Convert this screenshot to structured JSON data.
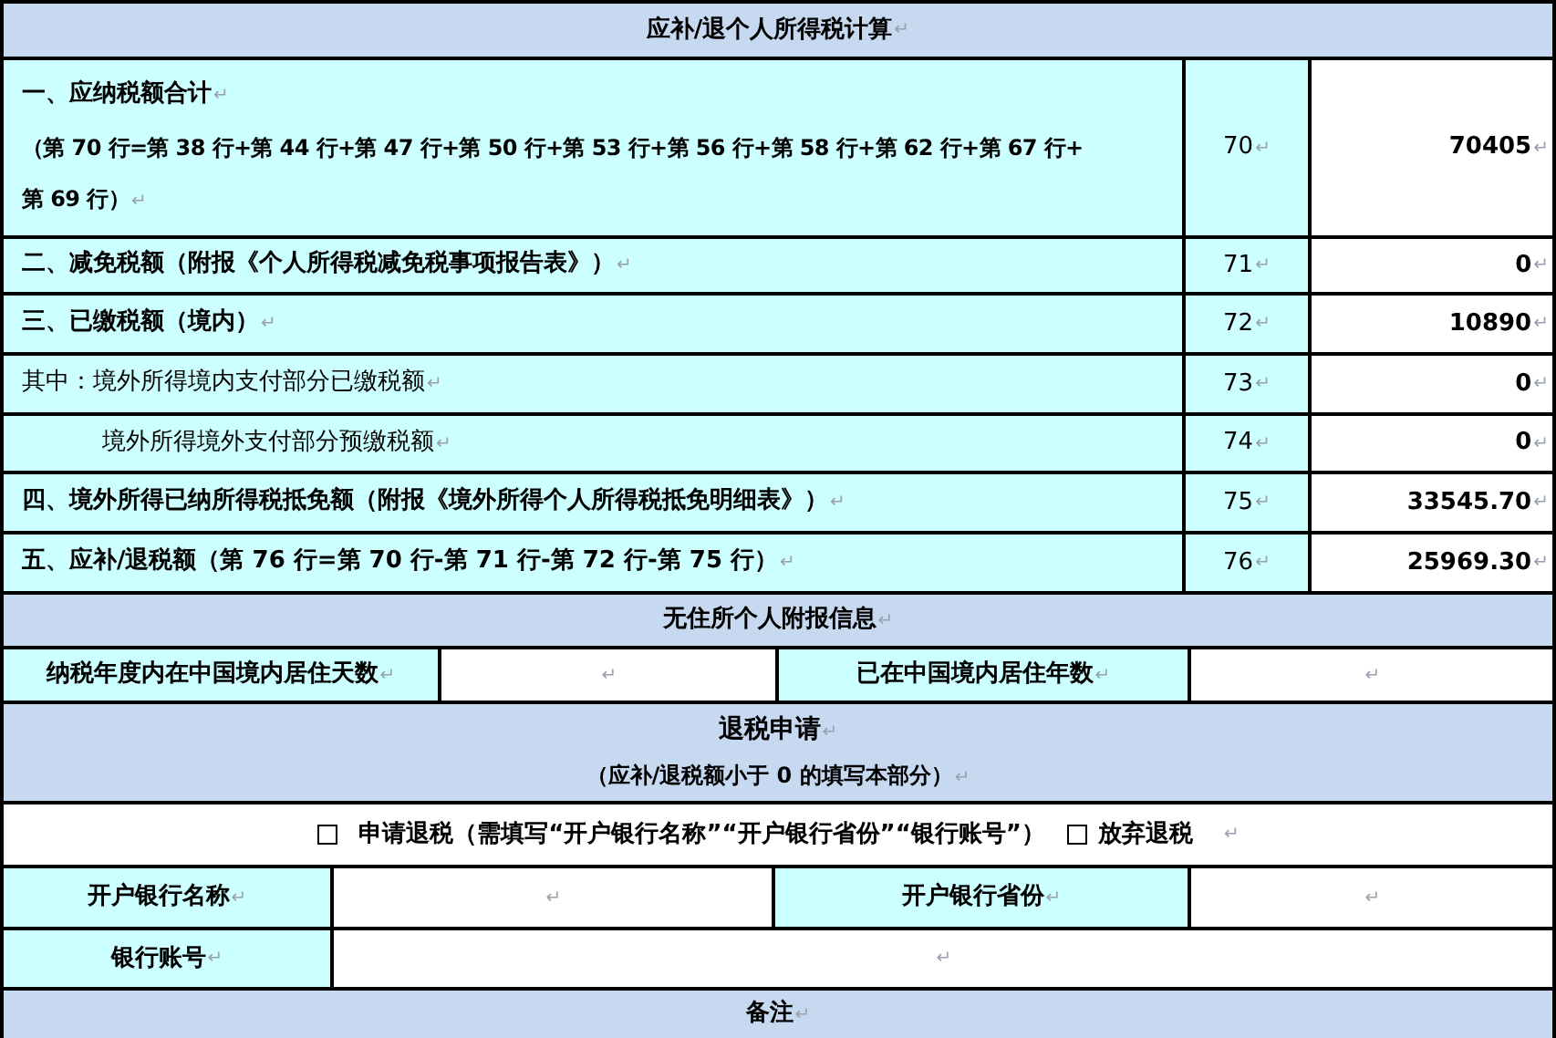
{
  "title": {
    "text": "应补/退个人所得税计算",
    "mark": "↵"
  },
  "tax_rows": [
    {
      "kind": "heading",
      "label": "一、应纳税额合计",
      "label_mark": "↵",
      "note_lines": [
        "（第 70 行=第 38 行+第 44 行+第 47 行+第 50 行+第 53 行+第 56 行+第 58 行+第 62 行+第 67 行+",
        "第 69 行）"
      ],
      "note_mark": "↵",
      "line": "70",
      "line_mark": "↵",
      "value": "70405",
      "value_mark": "↵"
    },
    {
      "kind": "heading",
      "label": "二、减免税额（附报《个人所得税减免税事项报告表》）",
      "label_mark": "↵",
      "line": "71",
      "line_mark": "↵",
      "value": "0",
      "value_mark": "↵"
    },
    {
      "kind": "heading",
      "label": "三、已缴税额（境内）",
      "label_mark": "↵",
      "line": "72",
      "line_mark": "↵",
      "value": "10890",
      "value_mark": "↵"
    },
    {
      "kind": "sub",
      "label": "其中：境外所得境内支付部分已缴税额",
      "label_mark": "↵",
      "line": "73",
      "line_mark": "↵",
      "value": "0",
      "value_mark": "↵"
    },
    {
      "kind": "subitem",
      "label": "境外所得境外支付部分预缴税额",
      "label_mark": "↵",
      "line": "74",
      "line_mark": "↵",
      "value": "0",
      "value_mark": "↵"
    },
    {
      "kind": "heading",
      "label": "四、境外所得已纳所得税抵免额（附报《境外所得个人所得税抵免明细表》）",
      "label_mark": "↵",
      "line": "75",
      "line_mark": "↵",
      "value": "33545.70",
      "value_mark": "↵"
    },
    {
      "kind": "heading",
      "label": "五、应补/退税额（第 76 行=第 70 行-第 71 行-第 72 行-第 75 行）",
      "label_mark": "↵",
      "line": "76",
      "line_mark": "↵",
      "value": "25969.30",
      "value_mark": "↵"
    }
  ],
  "nonresident": {
    "title": "无住所个人附报信息",
    "title_mark": "↵",
    "fields": [
      {
        "label": "纳税年度内在中国境内居住天数",
        "label_mark": "↵",
        "value_mark": "↵"
      },
      {
        "label": "已在中国境内居住年数",
        "label_mark": "↵",
        "value_mark": "↵"
      }
    ]
  },
  "refund": {
    "title": "退税申请",
    "title_mark": "↵",
    "subtitle": "（应补/退税额小于 0 的填写本部分）",
    "subtitle_mark": "↵",
    "options": [
      {
        "label": "申请退税（需填写“开户银行名称”“开户银行省份”“银行账号”）",
        "checked": false
      },
      {
        "label": "放弃退税",
        "checked": false
      }
    ],
    "options_mark": "↵",
    "bank_fields": [
      {
        "label": "开户银行名称",
        "label_mark": "↵",
        "value_mark": "↵"
      },
      {
        "label": "开户银行省份",
        "label_mark": "↵",
        "value_mark": "↵"
      }
    ],
    "account": {
      "label": "银行账号",
      "label_mark": "↵",
      "value_mark": "↵"
    }
  },
  "notes": {
    "title": "备注",
    "mark": "↵"
  }
}
